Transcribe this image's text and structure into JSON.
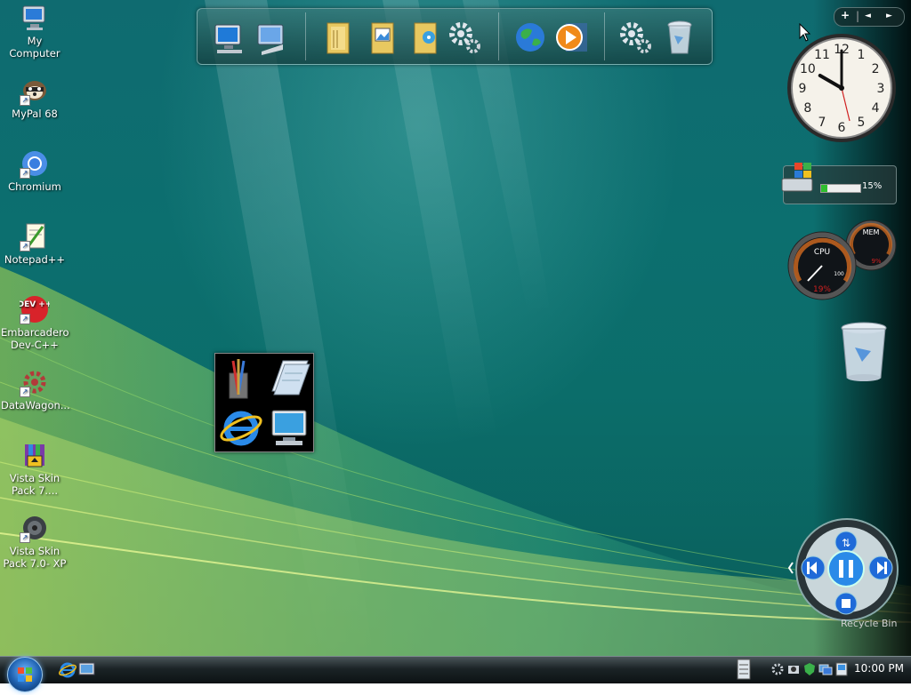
{
  "desktop_icons": [
    {
      "label": "My Computer"
    },
    {
      "label": "MyPal 68"
    },
    {
      "label": "Chromium"
    },
    {
      "label": "Notepad++"
    },
    {
      "label": "Embarcadero Dev-C++",
      "badge": "DEV ++"
    },
    {
      "label": "DataWagon..."
    },
    {
      "label": "Vista Skin Pack 7...."
    },
    {
      "label": "Vista Skin Pack 7.0- XP"
    }
  ],
  "dock_icons": [
    "computer-icon",
    "control-panel-icon",
    "documents-folder-icon",
    "pictures-folder-icon",
    "music-folder-icon",
    "settings-gears-icon",
    "internet-globe-icon",
    "media-player-icon",
    "system-gears-icon",
    "recycle-bin-icon"
  ],
  "quick_launch_icons": [
    "paint-icon",
    "notepad-icon",
    "internet-explorer-icon",
    "my-computer-icon"
  ],
  "sidebar": {
    "controls": {
      "add": "+",
      "prev": "◄",
      "next": "►"
    },
    "clock": {
      "hour": 10,
      "minute": 0,
      "numerals": [
        "12",
        "1",
        "2",
        "3",
        "4",
        "5",
        "6",
        "7",
        "8",
        "9",
        "10",
        "11"
      ]
    },
    "drive_meter": {
      "percent": 15,
      "label": "15%"
    },
    "cpu_meter": {
      "cpu_label": "CPU",
      "mem_label": "MEM",
      "scale_max": "100",
      "cpu_value": "19%",
      "mem_value": "9%"
    },
    "media_player": {
      "label": "Recycle Bin"
    }
  },
  "taskbar": {
    "quick_launch": [
      "internet-explorer-icon",
      "show-desktop-icon"
    ],
    "tray_icons": [
      "keyboard-icon",
      "settings-icon",
      "camera-icon",
      "shield-icon",
      "network-icon",
      "display-icon"
    ],
    "time": "10:00 PM"
  },
  "colors": {
    "desktop": "#0c6f6f",
    "accent_green": "#2fbf2f",
    "taskbar": "#1b2326"
  }
}
